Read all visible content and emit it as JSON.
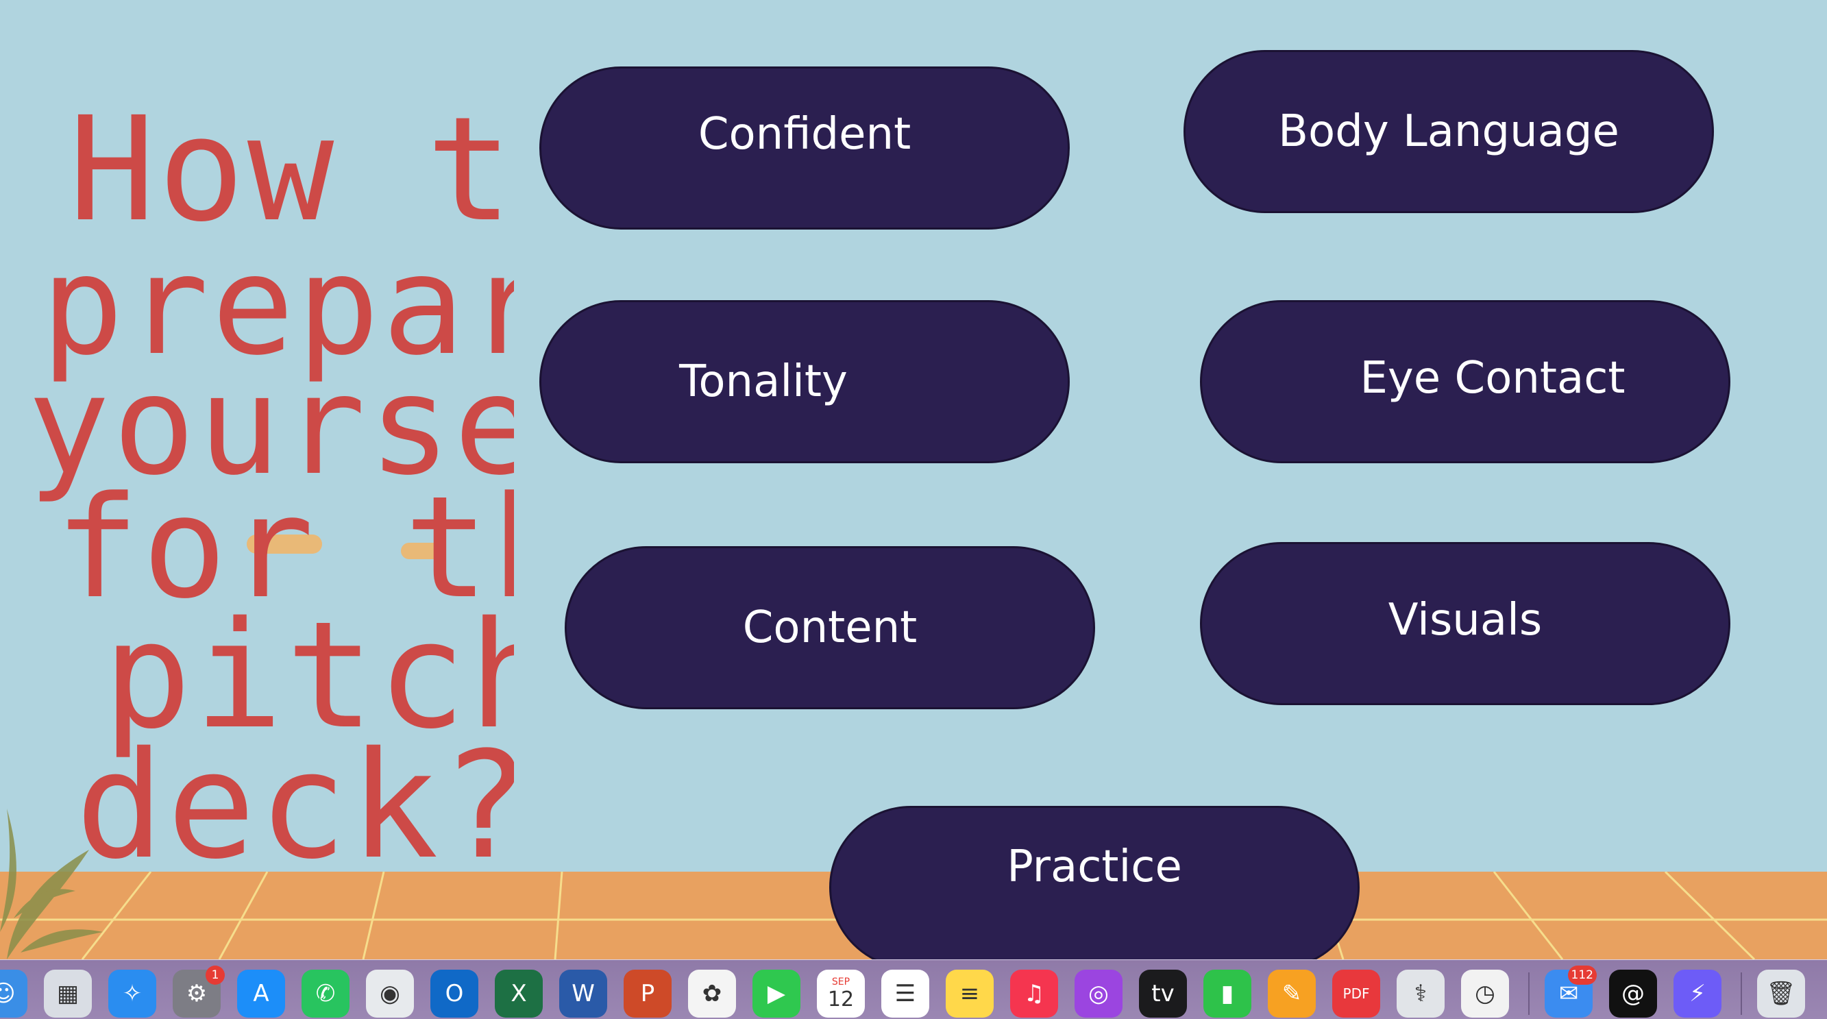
{
  "slide": {
    "title_lines": [
      "How to",
      "prepare",
      "yourself",
      "for the",
      "pitch",
      "deck?"
    ],
    "buttons": {
      "confident": "Confident",
      "body_language": "Body Language",
      "tonality": "Tonality",
      "eye_contact": "Eye Contact",
      "content": "Content",
      "visuals": "Visuals",
      "practice": "Practice"
    },
    "colors": {
      "background": "#b0d4df",
      "button": "#2b1f50",
      "title": "#cd4a47",
      "floor": "#e8a160"
    }
  },
  "dock": {
    "items": [
      {
        "name": "finder-icon",
        "glyph": "☺",
        "color": "#3a8ee6"
      },
      {
        "name": "launchpad-icon",
        "glyph": "▦",
        "color": "#d9dde4"
      },
      {
        "name": "safari-icon",
        "glyph": "✧",
        "color": "#2a8df0"
      },
      {
        "name": "system-settings-icon",
        "glyph": "⚙",
        "color": "#7d7d85",
        "badge": "1"
      },
      {
        "name": "app-store-icon",
        "glyph": "A",
        "color": "#1c8ef9"
      },
      {
        "name": "whatsapp-icon",
        "glyph": "✆",
        "color": "#28c45f"
      },
      {
        "name": "chrome-icon",
        "glyph": "◉",
        "color": "#e7eaed"
      },
      {
        "name": "outlook-icon",
        "glyph": "O",
        "color": "#1069c7"
      },
      {
        "name": "excel-icon",
        "glyph": "X",
        "color": "#1d7044"
      },
      {
        "name": "word-icon",
        "glyph": "W",
        "color": "#2a5aa8"
      },
      {
        "name": "powerpoint-icon",
        "glyph": "P",
        "color": "#ce4a28"
      },
      {
        "name": "photos-icon",
        "glyph": "✿",
        "color": "#f4f4f4"
      },
      {
        "name": "facetime-icon",
        "glyph": "▶",
        "color": "#2fc84f"
      },
      {
        "name": "calendar-icon",
        "glyph": "12",
        "color": "#ffffff",
        "label": "SEP"
      },
      {
        "name": "reminders-icon",
        "glyph": "☰",
        "color": "#ffffff"
      },
      {
        "name": "notes-icon",
        "glyph": "≡",
        "color": "#ffd84a"
      },
      {
        "name": "music-icon",
        "glyph": "♫",
        "color": "#f5354f"
      },
      {
        "name": "podcasts-icon",
        "glyph": "◎",
        "color": "#9b45e0"
      },
      {
        "name": "apple-tv-icon",
        "glyph": "tv",
        "color": "#1b1b1d"
      },
      {
        "name": "numbers-icon",
        "glyph": "▮",
        "color": "#2ec24a"
      },
      {
        "name": "pages-icon",
        "glyph": "✎",
        "color": "#f7a122"
      },
      {
        "name": "pdf-expert-icon",
        "glyph": "PDF",
        "color": "#e8383c"
      },
      {
        "name": "disk-utility-icon",
        "glyph": "⚕",
        "color": "#e1e4e8"
      },
      {
        "name": "clock-icon",
        "glyph": "◷",
        "color": "#f2f2f2"
      },
      {
        "name": "mail-icon",
        "glyph": "✉",
        "color": "#3b8cf0",
        "badge": "112"
      },
      {
        "name": "arc-icon",
        "glyph": "@",
        "color": "#111111"
      },
      {
        "name": "messenger-icon",
        "glyph": "⚡",
        "color": "#6d5cf7"
      },
      {
        "name": "trash-icon",
        "glyph": "🗑",
        "color": "#dfe3e8"
      }
    ]
  }
}
